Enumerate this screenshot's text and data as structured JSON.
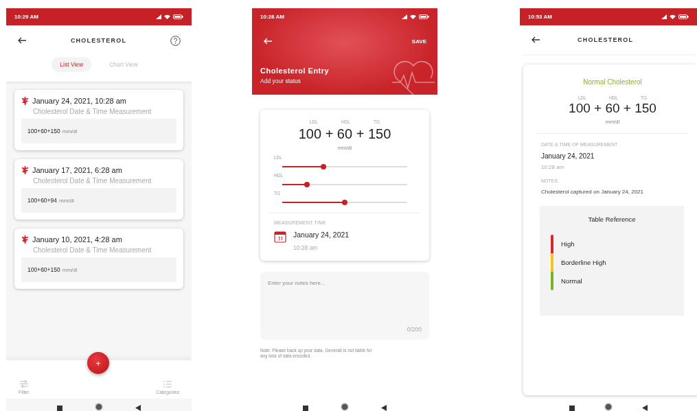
{
  "list_screen": {
    "status_time": "10:29 AM",
    "title": "CHOLESTEROL",
    "tabs": [
      {
        "label": "List View",
        "selected": true
      },
      {
        "label": "Chart View",
        "selected": false
      }
    ],
    "entries": [
      {
        "datetime": "January 24, 2021, 10:28 am",
        "subtitle": "Cholesterol Date & Time Measurement",
        "value": "100+60+150",
        "unit": "mm/dl"
      },
      {
        "datetime": "January 17, 2021, 6:28 am",
        "subtitle": "Cholesterol Date & Time Measurement",
        "value": "100+60+94",
        "unit": "mm/dl"
      },
      {
        "datetime": "January 10, 2021, 4:28 am",
        "subtitle": "Cholesterol Date & Time Measurement",
        "value": "100+60+150",
        "unit": "mm/dl"
      }
    ],
    "fab": "+",
    "bottom_nav": [
      {
        "kind": "filter",
        "label": "Filter"
      },
      {
        "kind": "categories",
        "label": "Categories"
      }
    ]
  },
  "entry_screen": {
    "status_time": "10:28 AM",
    "save": "SAVE",
    "title": "Cholesterol Entry",
    "subtitle": "Add your status",
    "reading": {
      "labels": [
        "LDL",
        "HDL",
        "TG"
      ],
      "value": "100 + 60 + 150",
      "unit": "mm/dl"
    },
    "sliders": [
      {
        "label": "LDL",
        "level": 0.33
      },
      {
        "label": "HDL",
        "level": 0.2
      },
      {
        "label": "TG",
        "level": 0.5
      }
    ],
    "measurement": {
      "label": "MEASUREMENT TIME",
      "date": "January 24, 2021",
      "time": "10:28 am"
    },
    "notes": {
      "placeholder": "Enter your notes here...",
      "counter": "0/200"
    },
    "disclaimer": "Note: Please back up your data, Generali is not liable for any loss of data encoded."
  },
  "detail_screen": {
    "status_time": "10:53 AM",
    "title": "CHOLESTEROL",
    "status_label": "Normal Cholesterol",
    "reading": {
      "labels": [
        "LDL",
        "HDL",
        "TG"
      ],
      "value": "100 + 60 + 150",
      "unit": "mm/dl"
    },
    "date_label": "DATE & TIME OF MEASUREMENT",
    "date": "January 24, 2021",
    "time": "10:28 am",
    "notes_label": "NOTES",
    "notes": "Cholesterol captured on January 24, 2021",
    "reference": {
      "title": "Table Reference",
      "levels": [
        {
          "label": "High",
          "color": "#d8262b"
        },
        {
          "label": "Borderline High",
          "color": "#f5c518"
        },
        {
          "label": "Normal",
          "color": "#7bb12a"
        }
      ]
    }
  }
}
